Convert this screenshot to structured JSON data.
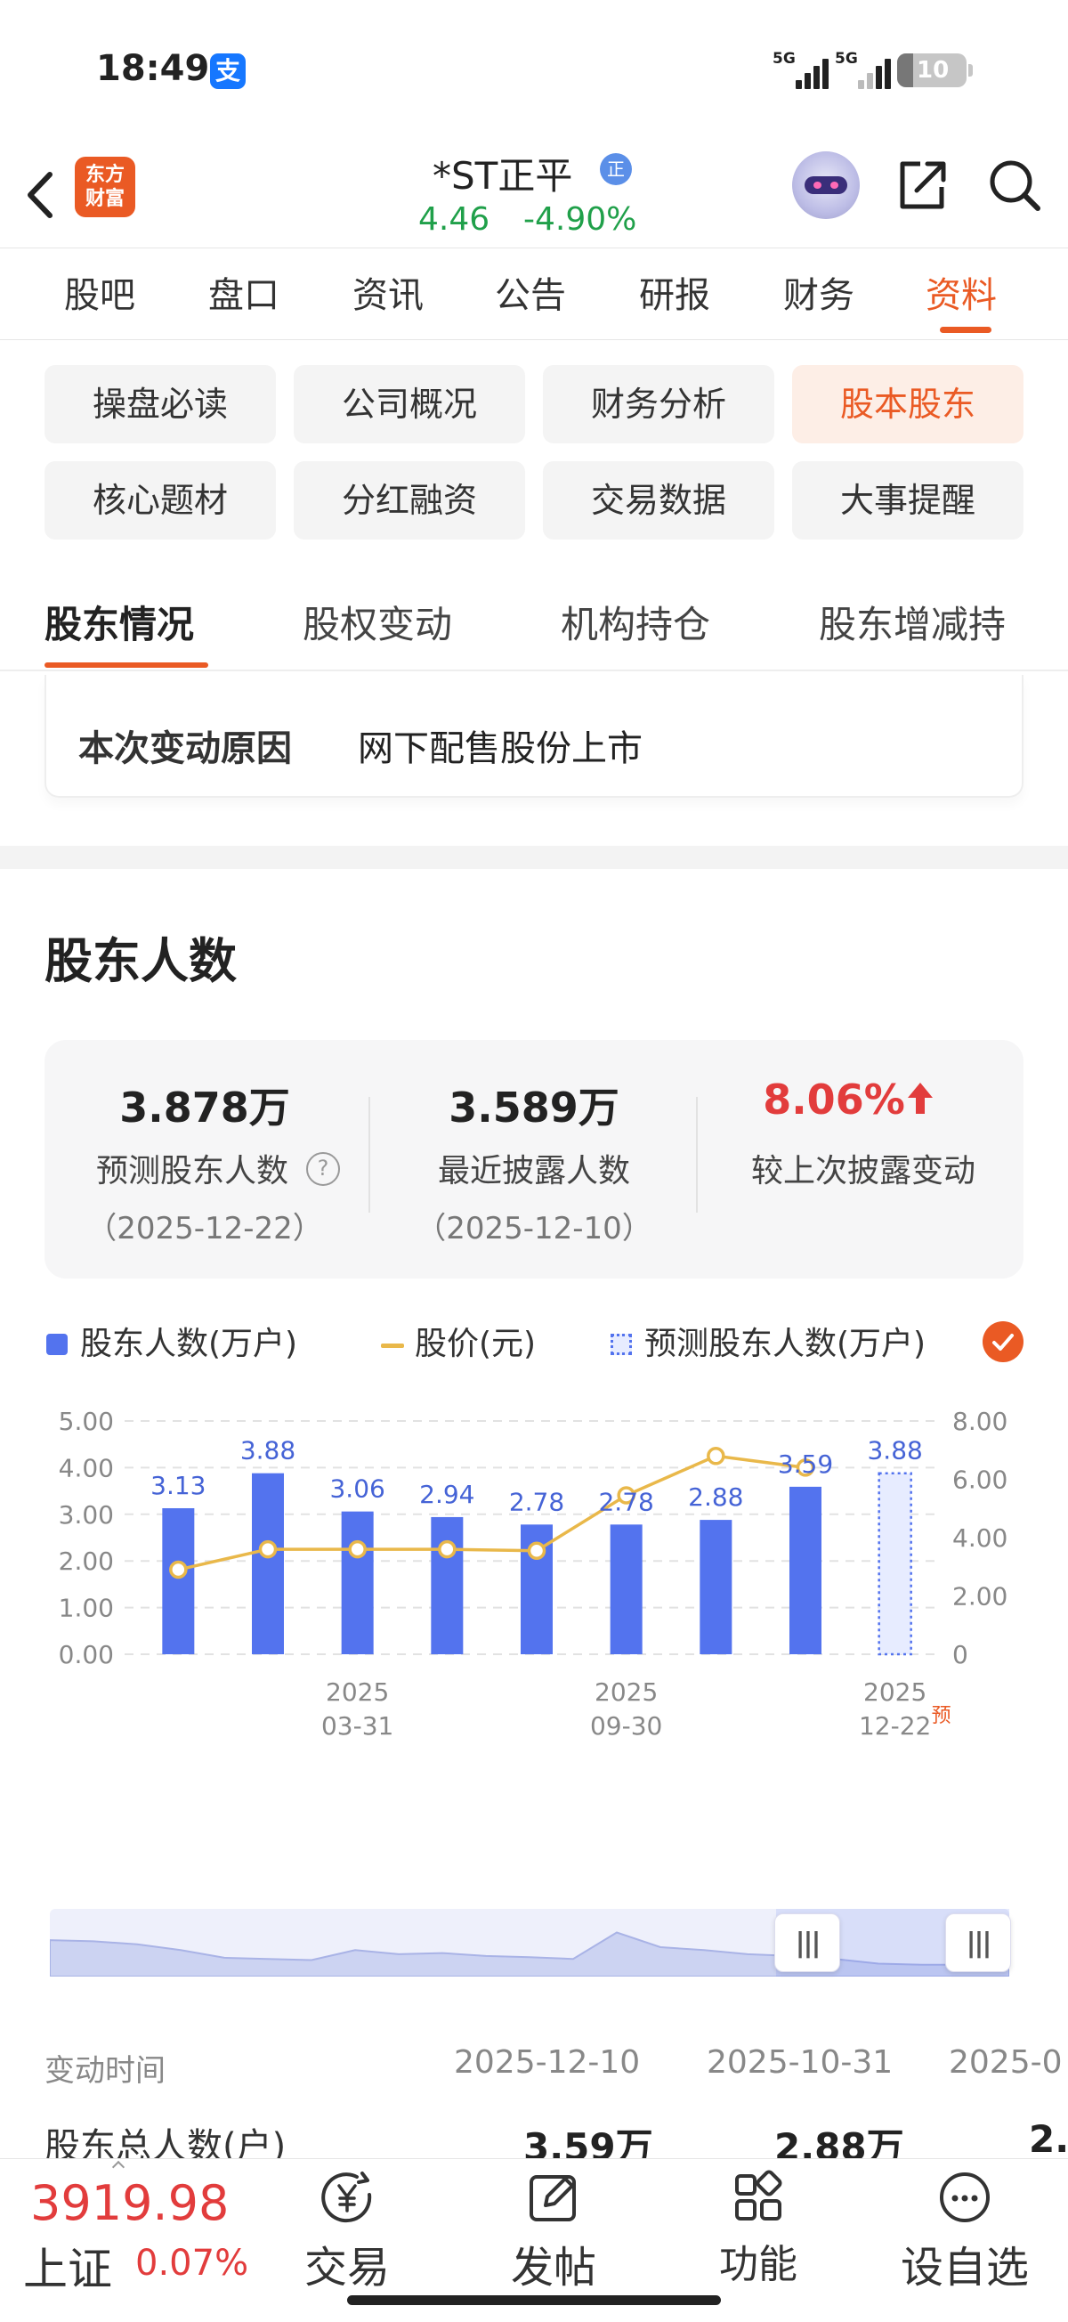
{
  "status_bar": {
    "time": "18:49",
    "alipay_icon": "支",
    "signal_1_label": "5G",
    "signal_2_label": "5G",
    "battery": "10"
  },
  "header": {
    "logo_text_1": "东方",
    "logo_text_2": "财富",
    "stock_name": "*ST正平",
    "badge": "正",
    "price": "4.46",
    "change": "-4.90%",
    "price_color": "#20a04a"
  },
  "main_tabs": [
    "股吧",
    "盘口",
    "资讯",
    "公告",
    "研报",
    "财务",
    "资料"
  ],
  "main_tabs_active": "资料",
  "info_grid": [
    [
      "操盘必读",
      "公司概况",
      "财务分析",
      "股本股东"
    ],
    [
      "核心题材",
      "分红融资",
      "交易数据",
      "大事提醒"
    ]
  ],
  "info_grid_active": "股本股东",
  "sub_tabs": [
    "股东情况",
    "股权变动",
    "机构持仓",
    "股东增减持"
  ],
  "sub_tabs_active": "股东情况",
  "change_reason": {
    "label": "本次变动原因",
    "value": "网下配售股份上市"
  },
  "section_title": "股东人数",
  "stats": [
    {
      "value": "3.878万",
      "label": "预测股东人数",
      "date": "（2025-12-22）",
      "has_help": true
    },
    {
      "value": "3.589万",
      "label": "最近披露人数",
      "date": "（2025-12-10）"
    },
    {
      "value": "8.06%",
      "label": "较上次披露变动",
      "date": "",
      "color": "#e23c3c",
      "trend": "up-arrow"
    }
  ],
  "legend": {
    "bars": "股东人数(万户)",
    "line": "股价(元)",
    "forecast": "预测股东人数(万户)",
    "bar_color": "#5373ee",
    "line_color": "#e9b84a",
    "accent": "#ea5a24"
  },
  "chart_data": {
    "type": "bar",
    "categories": [
      "",
      "",
      "2025-03-31",
      "",
      "",
      "2025-09-30",
      "",
      "",
      "2025-12-22"
    ],
    "x_tick_labels": [
      {
        "index": 2,
        "year": "2025",
        "date": "03-31"
      },
      {
        "index": 5,
        "year": "2025",
        "date": "09-30"
      },
      {
        "index": 8,
        "year": "2025",
        "date": "12-22",
        "note": "预"
      }
    ],
    "series": [
      {
        "name": "股东人数(万户)",
        "type": "bar",
        "axis": "left",
        "values": [
          3.13,
          3.88,
          3.06,
          2.94,
          2.78,
          2.78,
          2.88,
          3.59,
          null
        ]
      },
      {
        "name": "预测股东人数(万户)",
        "type": "bar-dashed",
        "axis": "left",
        "values": [
          null,
          null,
          null,
          null,
          null,
          null,
          null,
          null,
          3.88
        ]
      },
      {
        "name": "股价(元)",
        "type": "line",
        "axis": "right",
        "values": [
          2.9,
          3.6,
          3.6,
          3.6,
          3.55,
          5.45,
          6.8,
          6.4,
          null
        ]
      }
    ],
    "data_labels": [
      "3.13",
      "3.88",
      "3.06",
      "2.94",
      "2.78",
      "2.78",
      "2.88",
      "3.59",
      "3.88"
    ],
    "left_axis": {
      "ticks": [
        "0.00",
        "1.00",
        "2.00",
        "3.00",
        "4.00",
        "5.00"
      ],
      "ylim": [
        0,
        5
      ]
    },
    "right_axis": {
      "ticks": [
        "0",
        "2.00",
        "4.00",
        "6.00",
        "8.00"
      ],
      "ylim": [
        0,
        8
      ]
    },
    "grid": true
  },
  "minimap_series": [
    0.62,
    0.6,
    0.55,
    0.45,
    0.32,
    0.3,
    0.28,
    0.45,
    0.38,
    0.4,
    0.35,
    0.33,
    0.3,
    0.75,
    0.5,
    0.45,
    0.38,
    0.35,
    0.3,
    0.22,
    0.2,
    0.2,
    0.2
  ],
  "detail_table": {
    "header_label": "变动时间",
    "dates": [
      "2025-12-10",
      "2025-10-31",
      "2025-0"
    ],
    "rows": [
      {
        "label": "股东总人数(户)",
        "values": [
          "3.59万",
          "2.88万",
          "2."
        ]
      }
    ]
  },
  "bottom_bar": {
    "index_value": "3919.98",
    "index_name": "上证",
    "index_change": "0.07%",
    "items": [
      {
        "label": "交易",
        "icon": "yen-circle-icon"
      },
      {
        "label": "发帖",
        "icon": "edit-post-icon"
      },
      {
        "label": "功能",
        "icon": "grid-apps-icon"
      },
      {
        "label": "设自选",
        "icon": "more-dots-icon"
      }
    ]
  }
}
